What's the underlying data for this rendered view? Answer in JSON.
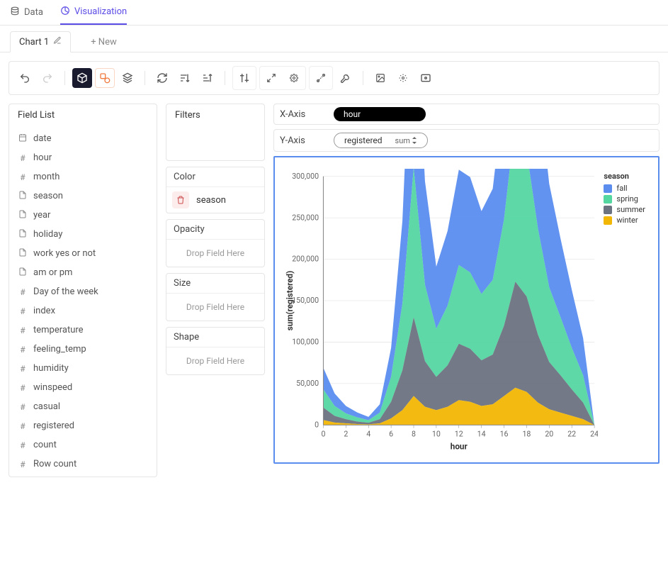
{
  "tabs": {
    "data": "Data",
    "visualization": "Visualization"
  },
  "chartTabs": {
    "active": "Chart 1",
    "new": "+ New"
  },
  "panels": {
    "fieldList": "Field List",
    "filters": "Filters",
    "color": "Color",
    "opacity": "Opacity",
    "size": "Size",
    "shape": "Shape",
    "dropHint": "Drop Field Here"
  },
  "fields": [
    {
      "name": "date",
      "type": "date"
    },
    {
      "name": "hour",
      "type": "number"
    },
    {
      "name": "month",
      "type": "number"
    },
    {
      "name": "season",
      "type": "text"
    },
    {
      "name": "year",
      "type": "text"
    },
    {
      "name": "holiday",
      "type": "text"
    },
    {
      "name": "work yes or not",
      "type": "text"
    },
    {
      "name": "am or pm",
      "type": "text"
    },
    {
      "name": "Day of the week",
      "type": "number"
    },
    {
      "name": "index",
      "type": "number"
    },
    {
      "name": "temperature",
      "type": "number"
    },
    {
      "name": "feeling_temp",
      "type": "number"
    },
    {
      "name": "humidity",
      "type": "number"
    },
    {
      "name": "winspeed",
      "type": "number"
    },
    {
      "name": "casual",
      "type": "number"
    },
    {
      "name": "registered",
      "type": "number"
    },
    {
      "name": "count",
      "type": "number"
    },
    {
      "name": "Row count",
      "type": "number"
    }
  ],
  "encodings": {
    "xAxisLabel": "X-Axis",
    "yAxisLabel": "Y-Axis",
    "x": "hour",
    "yField": "registered",
    "yAgg": "sum",
    "color": "season"
  },
  "chart_data": {
    "type": "area",
    "title": "",
    "xlabel": "hour",
    "ylabel": "sum(registered)",
    "xlim": [
      0,
      24
    ],
    "ylim": [
      0,
      300000
    ],
    "xticks": [
      0,
      2,
      4,
      6,
      8,
      10,
      12,
      14,
      16,
      18,
      20,
      22,
      24
    ],
    "yticks": [
      0,
      50000,
      100000,
      150000,
      200000,
      250000,
      300000
    ],
    "x": [
      0,
      1,
      2,
      3,
      4,
      5,
      6,
      7,
      8,
      9,
      10,
      11,
      12,
      13,
      14,
      15,
      16,
      17,
      18,
      19,
      20,
      21,
      22,
      23,
      24
    ],
    "legend_title": "season",
    "legend_position": "right",
    "series": [
      {
        "name": "fall",
        "color": "#5b8def",
        "values": [
          26000,
          15000,
          9000,
          6000,
          4000,
          10000,
          35000,
          100000,
          245000,
          125000,
          75000,
          90000,
          115000,
          115000,
          100000,
          110000,
          155000,
          280000,
          260000,
          180000,
          125000,
          95000,
          70000,
          45000,
          0
        ]
      },
      {
        "name": "spring",
        "color": "#54d6a1",
        "values": [
          22000,
          12000,
          7000,
          5000,
          3000,
          8000,
          30000,
          80000,
          180000,
          92000,
          58000,
          72000,
          95000,
          92000,
          80000,
          90000,
          128000,
          195000,
          175000,
          128000,
          90000,
          70000,
          50000,
          33000,
          0
        ]
      },
      {
        "name": "summer",
        "color": "#6b7280",
        "values": [
          15000,
          8000,
          5000,
          3000,
          2000,
          5000,
          20000,
          48000,
          95000,
          55000,
          40000,
          50000,
          68000,
          64000,
          55000,
          60000,
          85000,
          128000,
          115000,
          82000,
          57000,
          45000,
          32000,
          20000,
          0
        ]
      },
      {
        "name": "winter",
        "color": "#f2b705",
        "values": [
          6000,
          3000,
          2000,
          1200,
          800,
          2000,
          8000,
          18000,
          35000,
          22000,
          18000,
          22000,
          30000,
          28000,
          23000,
          25000,
          35000,
          45000,
          40000,
          27000,
          19000,
          15000,
          11000,
          7000,
          0
        ]
      }
    ],
    "stacked": true,
    "yticklabels": [
      "0",
      "50,000",
      "100,000",
      "150,000",
      "200,000",
      "250,000",
      "300,000"
    ]
  }
}
